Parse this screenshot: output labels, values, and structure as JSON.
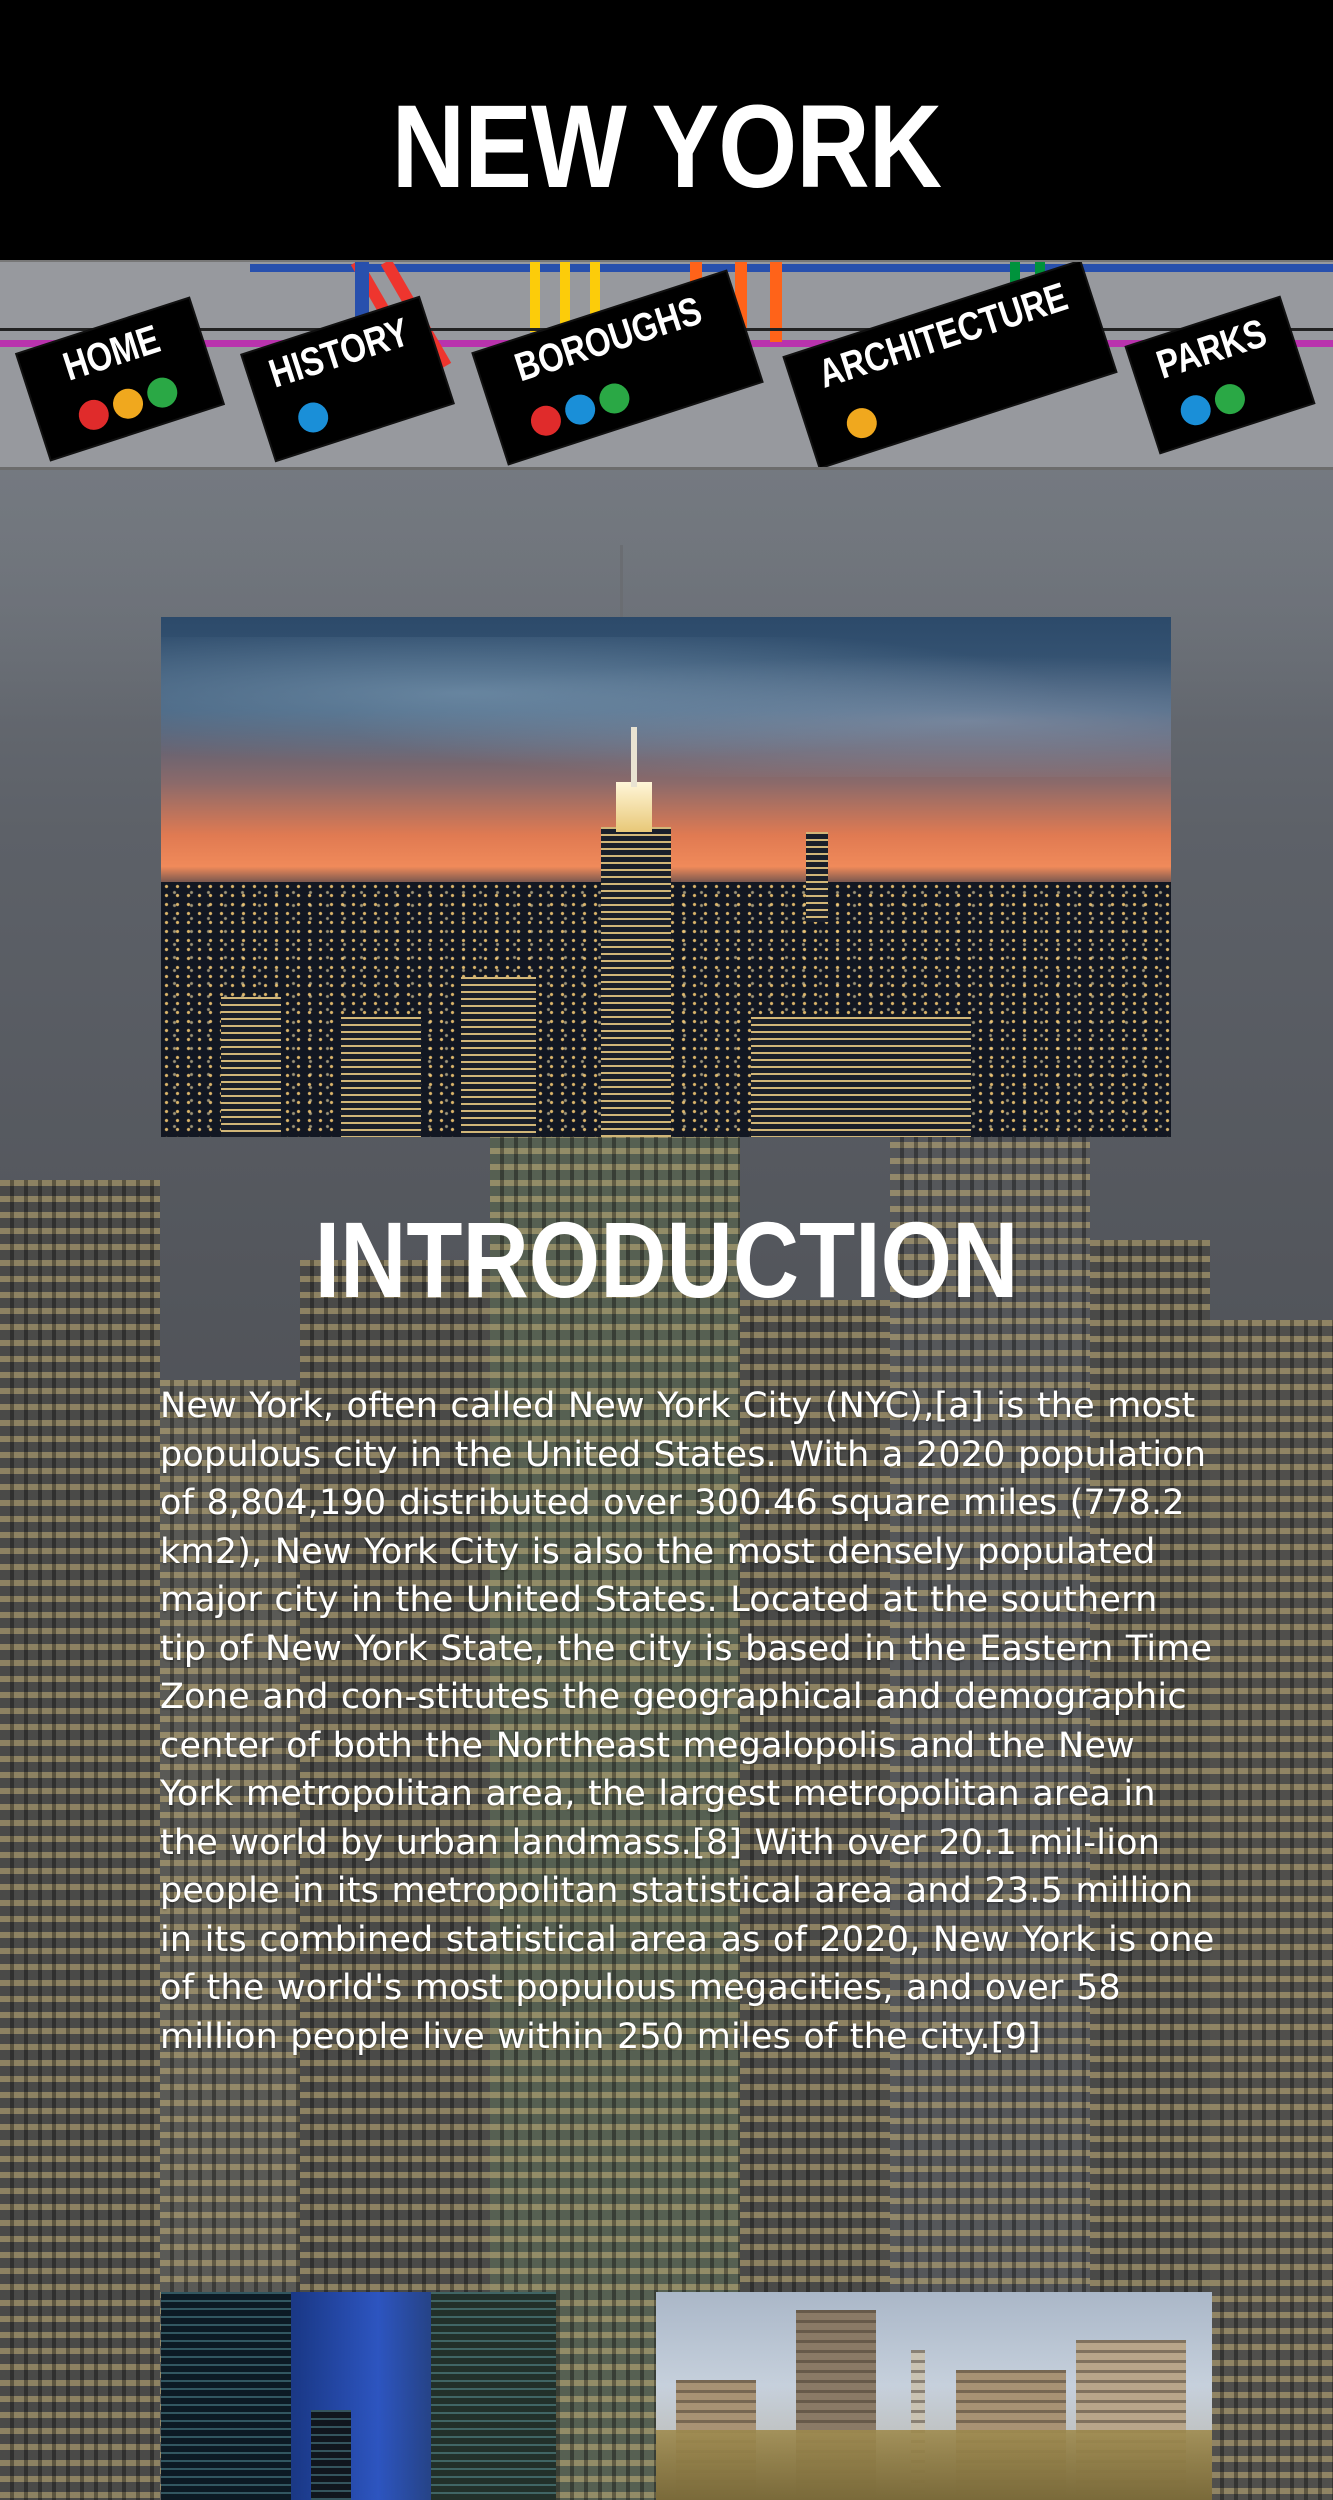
{
  "header": {
    "title": "NEW YORK"
  },
  "nav": {
    "items": [
      {
        "label": "HOME",
        "dots": [
          "#e02b2b",
          "#f0a81e",
          "#2aa845"
        ]
      },
      {
        "label": "HISTORY",
        "dots": [
          "#1a8fd8"
        ]
      },
      {
        "label": "BOROUGHS",
        "dots": [
          "#e02b2b",
          "#1a8fd8",
          "#2aa845"
        ]
      },
      {
        "label": "ARCHITECTURE",
        "dots": [
          "#f0a81e"
        ]
      },
      {
        "label": "PARKS",
        "dots": [
          "#1a8fd8",
          "#2aa845"
        ]
      }
    ],
    "line_colors": {
      "red": "#ee352e",
      "blue": "#2850ad",
      "yellow": "#fccc0a",
      "orange": "#ff6319",
      "green": "#00933c",
      "purple": "#b933ad"
    }
  },
  "intro": {
    "heading": "INTRODUCTION",
    "body": "New York, often called New York City (NYC),[a] is the most populous city in the United States. With a 2020 population of 8,804,190 distributed over 300.46 square miles (778.2 km2), New York City is also the most densely populated major city in the United States. Located at the southern tip of New York State, the city is based in the Eastern Time Zone and con-stitutes the geographical and demographic center of both the Northeast megalopolis and the New York metropolitan area, the largest metropolitan area in the world by urban landmass.[8] With over 20.1 mil-lion people in its metropolitan statistical area and 23.5 million in its combined statistical area as of 2020, New York is one of the world's most populous megacities, and over 58 million people live within 250 miles of the city.[9]"
  }
}
